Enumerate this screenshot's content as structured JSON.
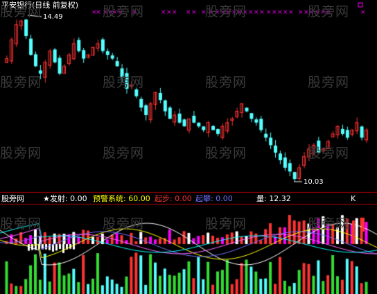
{
  "header": {
    "title": "平安银行(日线 前复权)",
    "max_label": "14.49",
    "min_label": "10.03"
  },
  "indicator_bar": {
    "name": "股旁网",
    "items": [
      {
        "label": "★发射:",
        "value": "0.00",
        "color": "#ffffff"
      },
      {
        "label": "预警系统:",
        "value": "60.00",
        "color": "#ffff00"
      },
      {
        "label": "起步:",
        "value": "0.00",
        "color": "#ff3333"
      },
      {
        "label": "起攀:",
        "value": "0.00",
        "color": "#6f6fff"
      },
      {
        "label": "量:",
        "value": "12.32",
        "color": "#ffffff"
      }
    ],
    "k_label": "K"
  },
  "watermark": "股旁网",
  "colors": {
    "background": "#000000",
    "up_candle": "#ff3333",
    "down_candle": "#54ffff",
    "divider": "#aa0000",
    "markers": "#ff00ff",
    "green_bars": "#33dd33",
    "white_bars": "#ffffff",
    "magenta_bars": "#ff00ff"
  },
  "chart_data": {
    "type": "candlestick",
    "price_range": [
      10.03,
      14.49
    ],
    "closes": [
      13.3,
      13.8,
      14.2,
      14.3,
      13.9,
      13.4,
      13.1,
      12.9,
      13.2,
      13.5,
      13.2,
      12.9,
      13.1,
      13.4,
      13.7,
      13.5,
      13.3,
      13.4,
      13.6,
      13.7,
      13.5,
      13.4,
      13.3,
      13.1,
      12.8,
      12.5,
      12.6,
      12.3,
      12.0,
      11.8,
      12.1,
      12.4,
      12.2,
      11.9,
      11.7,
      11.8,
      11.6,
      11.5,
      11.7,
      11.6,
      11.5,
      11.4,
      11.6,
      11.4,
      11.3,
      11.5,
      11.6,
      11.7,
      11.9,
      12.1,
      11.9,
      11.7,
      11.6,
      11.4,
      11.2,
      11.0,
      10.8,
      10.6,
      10.4,
      10.3,
      10.1,
      10.4,
      10.7,
      10.9,
      11.0,
      10.8,
      10.9,
      11.1,
      11.3,
      11.5,
      11.3,
      11.2,
      11.4,
      11.6,
      11.2,
      11.4
    ]
  }
}
